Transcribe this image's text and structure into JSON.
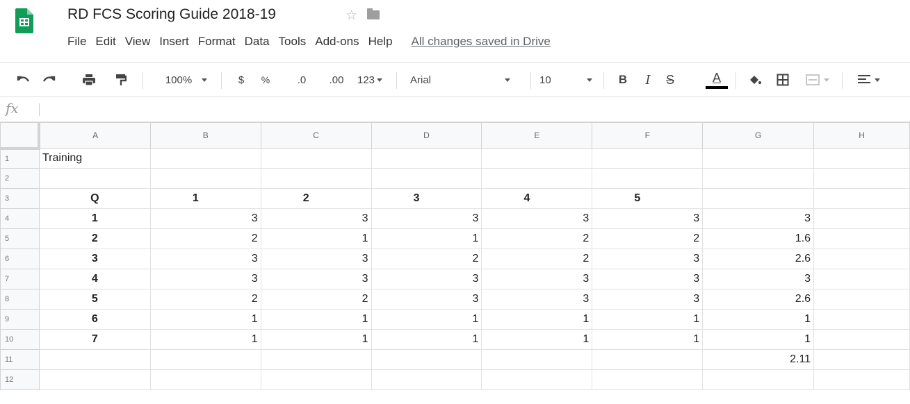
{
  "app": {
    "doc_title": "RD FCS Scoring Guide 2018-19",
    "star": "☆",
    "menus": [
      "File",
      "Edit",
      "View",
      "Insert",
      "Format",
      "Data",
      "Tools",
      "Add-ons",
      "Help"
    ],
    "save_status": "All changes saved in Drive"
  },
  "toolbar": {
    "zoom": "100%",
    "currency": "$",
    "percent": "%",
    "decrease_decimal": ".0",
    "increase_decimal": ".00",
    "number_format": "123",
    "font": "Arial",
    "font_size": "10",
    "bold": "B",
    "italic": "I",
    "strikethrough": "S",
    "text_color": "A"
  },
  "formula_bar": {
    "fx": "fx",
    "value": ""
  },
  "sheet": {
    "columns": [
      "A",
      "B",
      "C",
      "D",
      "E",
      "F",
      "G",
      "H"
    ],
    "rows": [
      {
        "n": "1",
        "cells": [
          "Training",
          "",
          "",
          "",
          "",
          "",
          "",
          ""
        ]
      },
      {
        "n": "2",
        "cells": [
          "",
          "",
          "",
          "",
          "",
          "",
          "",
          ""
        ]
      },
      {
        "n": "3",
        "cells": [
          "Q",
          "1",
          "2",
          "3",
          "4",
          "5",
          "",
          ""
        ]
      },
      {
        "n": "4",
        "cells": [
          "1",
          "3",
          "3",
          "3",
          "3",
          "3",
          "3",
          ""
        ]
      },
      {
        "n": "5",
        "cells": [
          "2",
          "2",
          "1",
          "1",
          "2",
          "2",
          "1.6",
          ""
        ]
      },
      {
        "n": "6",
        "cells": [
          "3",
          "3",
          "3",
          "2",
          "2",
          "3",
          "2.6",
          ""
        ]
      },
      {
        "n": "7",
        "cells": [
          "4",
          "3",
          "3",
          "3",
          "3",
          "3",
          "3",
          ""
        ]
      },
      {
        "n": "8",
        "cells": [
          "5",
          "2",
          "2",
          "3",
          "3",
          "3",
          "2.6",
          ""
        ]
      },
      {
        "n": "9",
        "cells": [
          "6",
          "1",
          "1",
          "1",
          "1",
          "1",
          "1",
          ""
        ]
      },
      {
        "n": "10",
        "cells": [
          "7",
          "1",
          "1",
          "1",
          "1",
          "1",
          "1",
          ""
        ]
      },
      {
        "n": "11",
        "cells": [
          "",
          "",
          "",
          "",
          "",
          "",
          "2.11",
          ""
        ]
      },
      {
        "n": "12",
        "cells": [
          "",
          "",
          "",
          "",
          "",
          "",
          "",
          ""
        ]
      }
    ]
  },
  "colors": {
    "sheets_green": "#0F9D58",
    "header_bg": "#f8f9fa",
    "grid_line": "#e2e2e2"
  }
}
